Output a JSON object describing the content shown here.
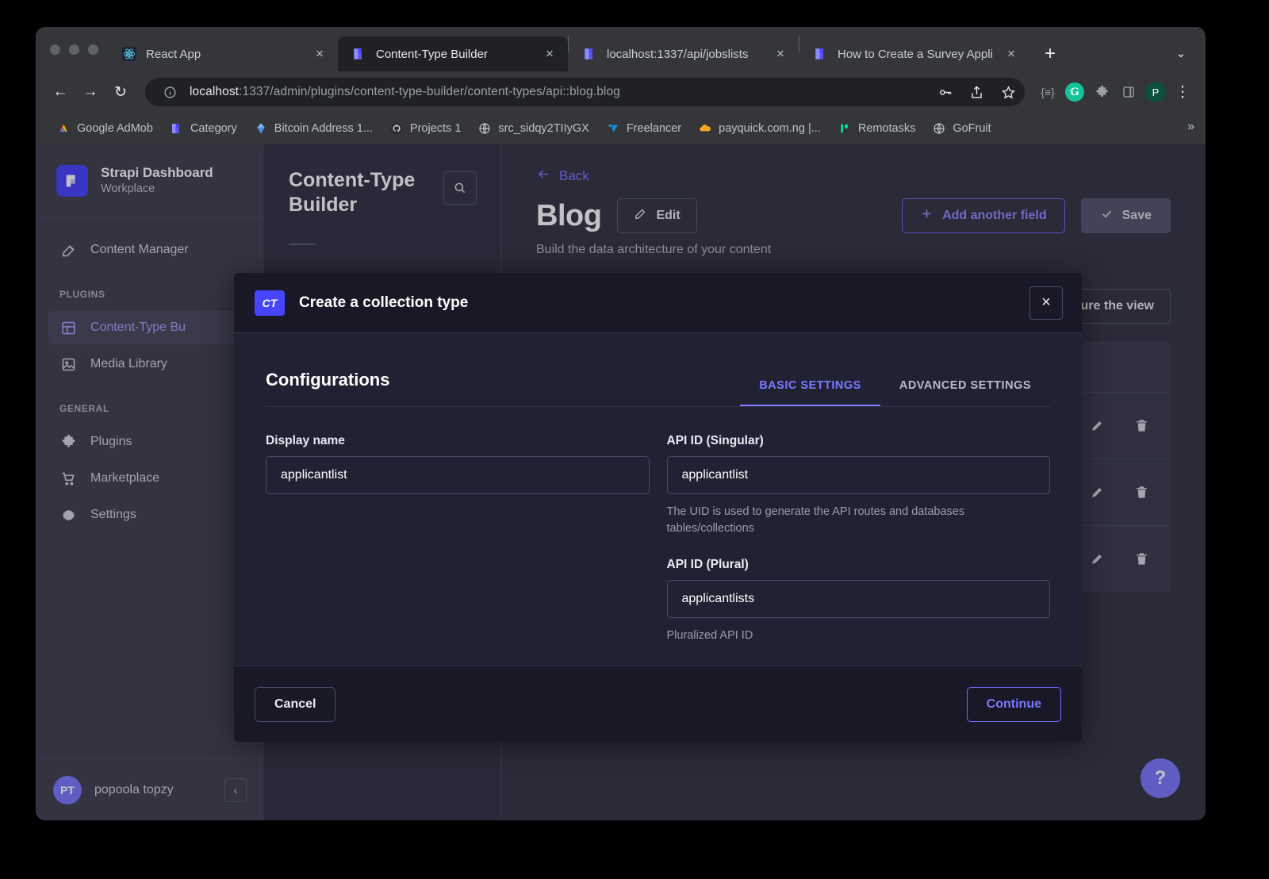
{
  "browser": {
    "tabs": [
      {
        "title": "React App",
        "icon": "react-icon",
        "active": false
      },
      {
        "title": "Content-Type Builder",
        "icon": "strapi-icon",
        "active": true
      },
      {
        "title": "localhost:1337/api/jobslists",
        "icon": "strapi-icon",
        "active": false
      },
      {
        "title": "How to Create a Survey Applic",
        "icon": "strapi-icon",
        "active": false
      }
    ],
    "new_tab_label": "+",
    "tab_list_menu_label": "⌄",
    "close_label": "×",
    "nav": {
      "back": "←",
      "forward": "→",
      "reload": "↻"
    },
    "omnibox": {
      "info_icon": "site-info-icon",
      "url_prefix": "localhost",
      "url_rest": ":1337/admin/plugins/content-type-builder/content-types/api::blog.blog",
      "password_icon": "key-icon",
      "share_icon": "share-icon",
      "bookmark_icon": "star-icon"
    },
    "extensions": [
      {
        "name": "json-viewer-icon",
        "glyph": "{≡}"
      },
      {
        "name": "grammarly-icon",
        "glyph": "G"
      },
      {
        "name": "extensions-puzzle-icon",
        "glyph": "❖"
      },
      {
        "name": "side-panel-icon",
        "glyph": "▮"
      },
      {
        "name": "profile-avatar",
        "glyph": "P"
      },
      {
        "name": "chrome-menu-icon",
        "glyph": "⋮"
      }
    ],
    "bookmarks": [
      {
        "label": "Google AdMob",
        "icon": "admob-icon"
      },
      {
        "label": "Category",
        "icon": "strapi-icon"
      },
      {
        "label": "Bitcoin Address 1...",
        "icon": "diamond-icon"
      },
      {
        "label": "Projects 1",
        "icon": "github-icon"
      },
      {
        "label": "src_sidqy2TIIyGX",
        "icon": "globe-icon"
      },
      {
        "label": "Freelancer",
        "icon": "freelancer-icon"
      },
      {
        "label": "payquick.com.ng |...",
        "icon": "cloud-icon"
      },
      {
        "label": "Remotasks",
        "icon": "remotasks-icon"
      },
      {
        "label": "GoFruit",
        "icon": "globe-icon"
      }
    ],
    "bookmarks_overflow_label": "»"
  },
  "sidebar": {
    "brand_name": "Strapi Dashboard",
    "brand_sub": "Workplace",
    "top_items": [
      {
        "label": "Content Manager",
        "icon": "pen-write-icon",
        "active": false
      }
    ],
    "sections": [
      {
        "label": "PLUGINS",
        "items": [
          {
            "label": "Content-Type Bu",
            "icon": "layout-grid-icon",
            "active": true
          },
          {
            "label": "Media Library",
            "icon": "image-icon",
            "active": false
          }
        ]
      },
      {
        "label": "GENERAL",
        "items": [
          {
            "label": "Plugins",
            "icon": "puzzle-icon",
            "active": false
          },
          {
            "label": "Marketplace",
            "icon": "cart-icon",
            "active": false
          },
          {
            "label": "Settings",
            "icon": "gear-icon",
            "active": false
          }
        ]
      }
    ],
    "user": {
      "initials": "PT",
      "name": "popoola topzy",
      "collapse_label": "‹"
    }
  },
  "ctb_panel": {
    "title": "Content-Type Builder",
    "search_icon": "search-icon"
  },
  "main": {
    "back_label": "Back",
    "back_icon": "arrow-left-icon",
    "title": "Blog",
    "edit_label": "Edit",
    "edit_icon": "pencil-icon",
    "add_field_label": "Add another field",
    "add_field_icon": "plus-icon",
    "save_label": "Save",
    "save_icon": "check-icon",
    "subtitle": "Build the data architecture of your content",
    "configure_label": "figure the view",
    "field_rows": [
      {
        "name": "",
        "type": "",
        "edit_icon": "pencil-icon",
        "delete_icon": "trash-icon"
      },
      {
        "name": "",
        "type": "",
        "edit_icon": "pencil-icon",
        "delete_icon": "trash-icon"
      },
      {
        "name": "",
        "type": "",
        "edit_icon": "pencil-icon",
        "delete_icon": "trash-icon"
      }
    ],
    "help_label": "?"
  },
  "modal": {
    "badge": "CT",
    "title": "Create a collection type",
    "close_label": "×",
    "configurations_heading": "Configurations",
    "tabs": [
      {
        "label": "BASIC SETTINGS",
        "active": true
      },
      {
        "label": "ADVANCED SETTINGS",
        "active": false
      }
    ],
    "fields": {
      "display_name": {
        "label": "Display name",
        "value": "applicantlist",
        "placeholder": ""
      },
      "api_id_singular": {
        "label": "API ID (Singular)",
        "value": "applicantlist",
        "placeholder": "",
        "hint": "The UID is used to generate the API routes and databases tables/collections"
      },
      "api_id_plural": {
        "label": "API ID (Plural)",
        "value": "applicantlists",
        "placeholder": "",
        "hint": "Pluralized API ID"
      }
    },
    "cancel_label": "Cancel",
    "continue_label": "Continue"
  },
  "colors": {
    "accent": "#4945ff",
    "accent_light": "#7b79ff",
    "sidebar_bg": "#414052",
    "main_bg": "#343446",
    "modal_bg": "#212134",
    "modal_header_bg": "#181826"
  }
}
